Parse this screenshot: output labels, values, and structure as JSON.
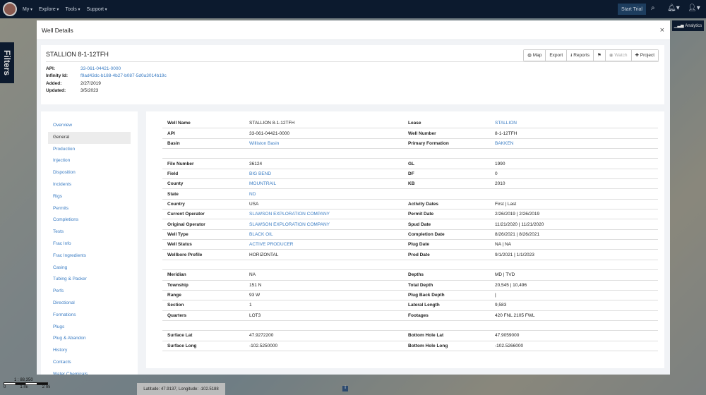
{
  "nav": {
    "menus": [
      "My",
      "Explore",
      "Tools",
      "Support"
    ],
    "start_trial": "Start Trial",
    "analytics": "Analytics"
  },
  "filters_label": "Filters",
  "map": {
    "scale": "1 : 88,350",
    "scale_ticks": [
      "0",
      "1 mi",
      "2 mi"
    ],
    "latlon": "Latitude: 47.9137, Longitude: -102.5188"
  },
  "modal": {
    "title": "Well Details",
    "close": "×"
  },
  "well": {
    "name": "STALLION 8-1-12TFH",
    "buttons": {
      "map": "Map",
      "export": "Export",
      "reports": "Reports",
      "watch": "Watch",
      "project": "Project"
    },
    "meta": [
      {
        "k": "API:",
        "v": "33-061-04421-0000",
        "link": true
      },
      {
        "k": "Infinity Id:",
        "v": "f9ad43dc-b188-4b27-b087-5d0a3014b19c",
        "link": true
      },
      {
        "k": "Added:",
        "v": "2/27/2019"
      },
      {
        "k": "Updated:",
        "v": "3/5/2023"
      }
    ]
  },
  "sidenav": [
    "Overview",
    "General",
    "Production",
    "Injection",
    "Disposition",
    "Incidents",
    "Rigs",
    "Permits",
    "Completions",
    "Tests",
    "Frac Info",
    "Frac Ingredients",
    "Casing",
    "Tubing & Packer",
    "Perfs",
    "Directional",
    "Formations",
    "Plugs",
    "Plug & Abandon",
    "History",
    "Contacts",
    "Water Chemicals"
  ],
  "active_nav": "General",
  "sections": [
    [
      [
        "Well Name",
        "STALLION 8-1-12TFH",
        0,
        "Lease",
        "STALLION",
        1
      ],
      [
        "API",
        "33-061-04421-0000",
        0,
        "Well Number",
        "8-1-12TFH",
        0
      ],
      [
        "Basin",
        "Williston Basin",
        1,
        "Primary Formation",
        "BAKKEN",
        1
      ]
    ],
    [
      [
        "File Number",
        "36124",
        0,
        "GL",
        "1990",
        0
      ],
      [
        "Field",
        "BIG BEND",
        1,
        "DF",
        "0",
        0
      ],
      [
        "County",
        "MOUNTRAIL",
        1,
        "KB",
        "2010",
        0
      ],
      [
        "State",
        "ND",
        1,
        "",
        "",
        0
      ],
      [
        "Country",
        "USA",
        0,
        "Activity Dates",
        "First | Last",
        0
      ],
      [
        "Current Operator",
        "SLAWSON EXPLORATION COMPANY",
        1,
        "Permit Date",
        "2/26/2019 | 2/26/2019",
        0
      ],
      [
        "Original Operator",
        "SLAWSON EXPLORATION COMPANY",
        1,
        "Spud Date",
        "11/21/2020 | 11/21/2020",
        0
      ],
      [
        "Well Type",
        "BLACK OIL",
        1,
        "Completion Date",
        "8/26/2021 | 8/26/2021",
        0
      ],
      [
        "Well Status",
        "ACTIVE PRODUCER",
        1,
        "Plug Date",
        "NA | NA",
        0
      ],
      [
        "Wellbore Profile",
        "HORIZONTAL",
        0,
        "Prod Date",
        "9/1/2021 | 1/1/2023",
        0
      ]
    ],
    [
      [
        "Meridian",
        "NA",
        0,
        "Depths",
        "MD | TVD",
        0
      ],
      [
        "Township",
        "151 N",
        0,
        "Total Depth",
        "20,545 | 10,496",
        0
      ],
      [
        "Range",
        "93 W",
        0,
        "Plug Back Depth",
        "|",
        0
      ],
      [
        "Section",
        "1",
        0,
        "Lateral Length",
        "9,583",
        0
      ],
      [
        "Quarters",
        "LOT3",
        0,
        "Footages",
        "420 FNL 2105 FWL",
        0
      ]
    ],
    [
      [
        "Surface Lat",
        "47.9272200",
        0,
        "Bottom Hole Lat",
        "47.9059000",
        0
      ],
      [
        "Surface Long",
        "-102.5250000",
        0,
        "Bottom Hole Long",
        "-102.5266000",
        0
      ]
    ]
  ]
}
